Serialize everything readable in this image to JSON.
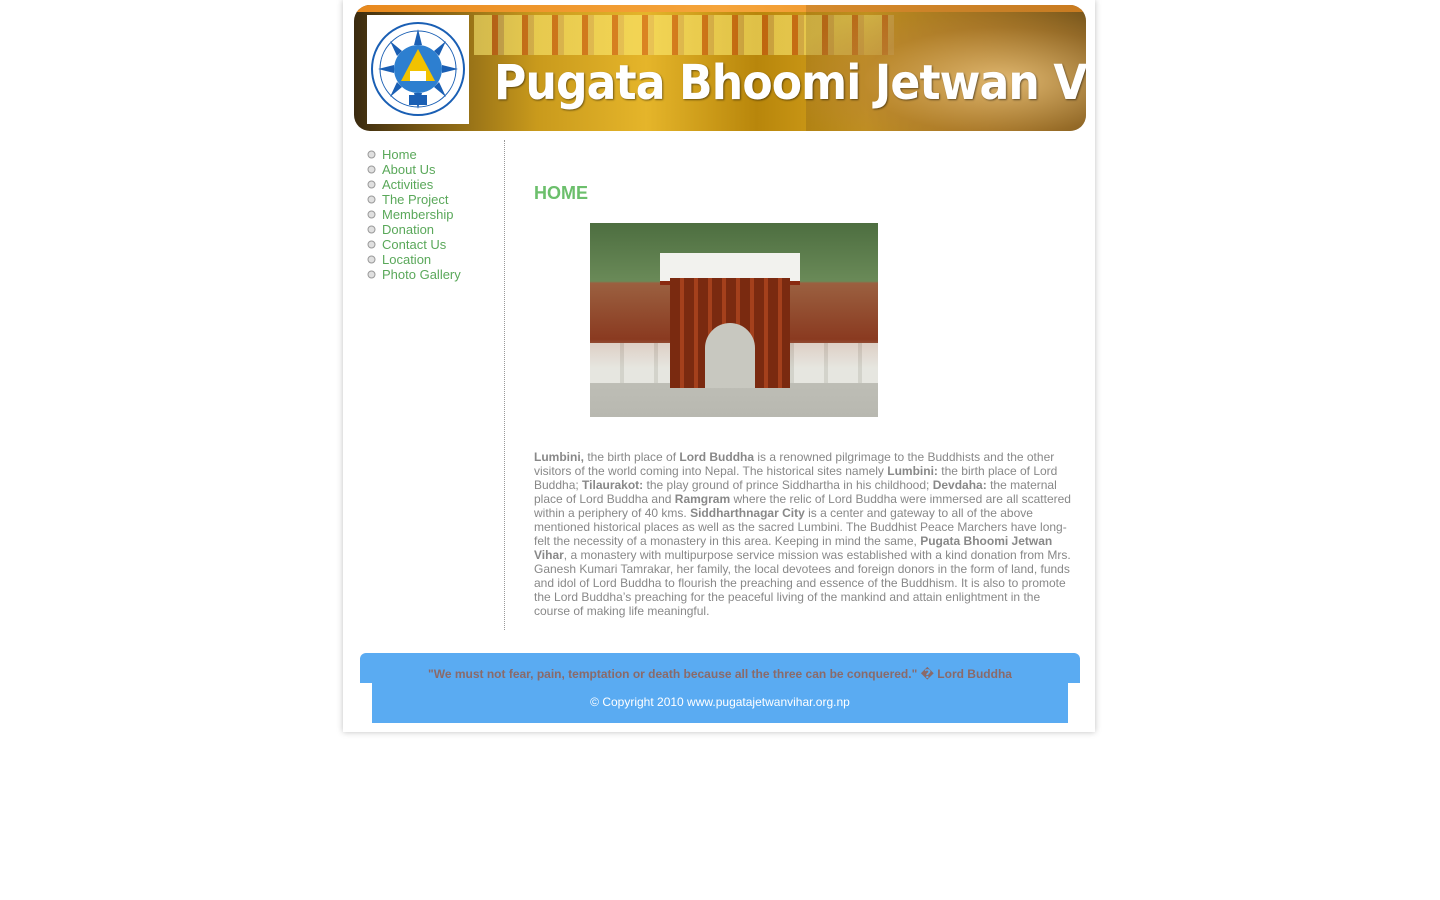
{
  "header": {
    "title": "Pugata Bhoomi Jetwan Vihar",
    "logo_icon": "dharma-wheel-logo-icon"
  },
  "nav": {
    "items": [
      {
        "label": "Home"
      },
      {
        "label": "About Us"
      },
      {
        "label": "Activities"
      },
      {
        "label": "The Project"
      },
      {
        "label": "Membership"
      },
      {
        "label": "Donation"
      },
      {
        "label": "Contact Us"
      },
      {
        "label": "Location"
      },
      {
        "label": "Photo Gallery"
      }
    ],
    "bullet_icon": "circle-bullet-icon"
  },
  "main": {
    "heading": "HOME",
    "photo_icon": "gate-photo",
    "paragraph": {
      "s1_b": "Lumbini,",
      "s1": " the birth place of ",
      "s2_b": "Lord Buddha",
      "s2": " is a renowned pilgrimage to the Buddhists and the other visitors of the world coming into Nepal. The historical sites namely ",
      "s3_b": "Lumbini:",
      "s3": " the birth place of Lord Buddha; ",
      "s4_b": "Tilaurakot:",
      "s4": " the play ground of prince Siddhartha in his childhood; ",
      "s5_b": "Devdaha:",
      "s5": " the maternal place of Lord Buddha and ",
      "s6_b": "Ramgram",
      "s6": " where the relic of Lord Buddha were immersed are all scattered within a periphery of 40 kms. ",
      "s7_b": "Siddharthnagar City",
      "s7": " is a center and gateway to all of the above mentioned historical places as well as the sacred Lumbini. The Buddhist Peace Marchers have long-felt the necessity of a monastery in this area. Keeping in mind the same, ",
      "s8_b": "Pugata Bhoomi Jetwan Vihar",
      "s8": ", a monastery with multipurpose service mission was established with a kind donation from Mrs. Ganesh Kumari Tamrakar, her family, the local devotees and foreign donors in the form of land, funds and idol of Lord Buddha to flourish the preaching and essence of the Buddhism. It is also to promote the Lord Buddha’s preaching for the peaceful living of the mankind and attain enlightment in the course of making life meaningful."
    }
  },
  "footer": {
    "quote": "\"We must not fear, pain, temptation or death because all the three can be conquered.\" � Lord Buddha",
    "copyright": "© Copyright 2010 www.pugatajetwanvihar.org.np"
  },
  "colors": {
    "nav_link": "#5aa85a",
    "heading": "#6cbf6c",
    "footer_bg": "#5aabf2",
    "banner_top": "#e8891e"
  }
}
